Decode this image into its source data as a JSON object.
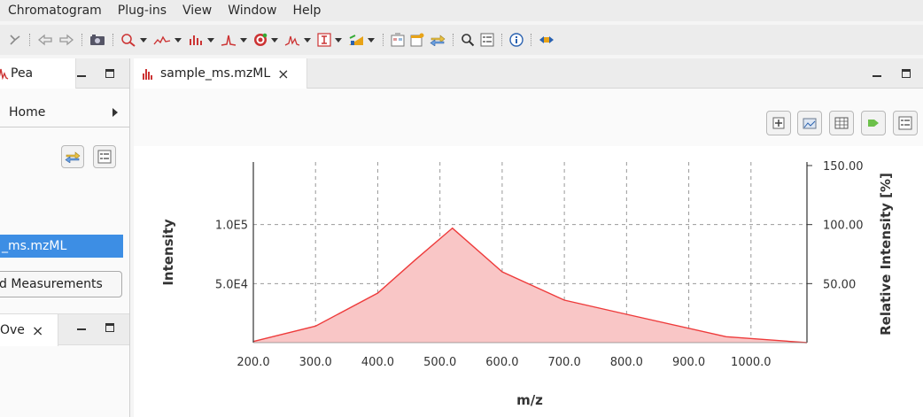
{
  "menubar": {
    "items": [
      "Chromatogram",
      "Plug-ins",
      "View",
      "Window",
      "Help"
    ]
  },
  "left_panel": {
    "top_tab_label": "Pea",
    "breadcrumb": "Home",
    "selected_file": "_ms.mzML",
    "measurements_button": "d Measurements",
    "overview_tab_label": "Ove"
  },
  "editor": {
    "tab_label": "sample_ms.mzML",
    "tab_close": "×"
  },
  "colors": {
    "accent_selection": "#3d8ee4",
    "series_line": "#ee3b3b",
    "series_fill": "#f9c6c6"
  },
  "chart_data": {
    "type": "area",
    "xlabel": "m/z",
    "ylabel": "Intensity",
    "y2label": "Relative Intensity [%]",
    "xlim": [
      200,
      1090
    ],
    "ylim": [
      0,
      150
    ],
    "x_ticks": [
      200,
      300,
      400,
      500,
      600,
      700,
      800,
      900,
      1000
    ],
    "x_tick_labels": [
      "200.0",
      "300.0",
      "400.0",
      "500.0",
      "600.0",
      "700.0",
      "800.0",
      "900.0",
      "1000.0"
    ],
    "y_ticks": [
      50,
      100
    ],
    "y_tick_labels": [
      "5.0E4",
      "1.0E5"
    ],
    "y2_ticks": [
      50,
      100,
      150
    ],
    "y2_tick_labels": [
      "50.00",
      "100.00",
      "150.00"
    ],
    "grid": true,
    "series": [
      {
        "x": [
          200,
          300,
          400,
          460,
          520,
          600,
          700,
          800,
          960,
          1090
        ],
        "y": [
          1,
          14,
          42,
          70,
          97,
          60,
          36,
          24,
          5,
          0
        ]
      }
    ]
  }
}
